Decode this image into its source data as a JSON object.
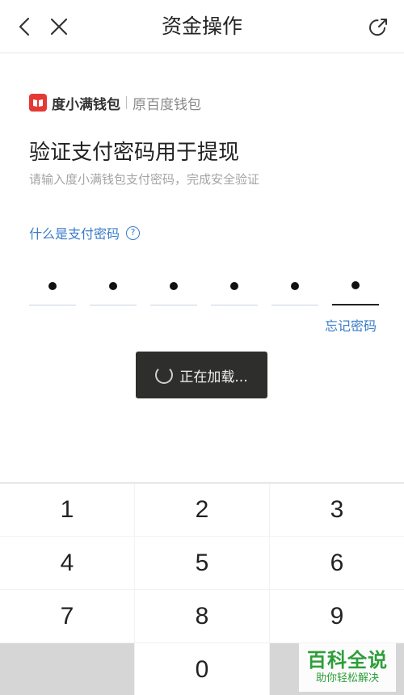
{
  "header": {
    "title": "资金操作"
  },
  "brand": {
    "name": "度小满钱包",
    "former_name": "原百度钱包",
    "color": "#e53935"
  },
  "main": {
    "heading": "验证支付密码用于提现",
    "subtitle": "请输入度小满钱包支付密码，完成安全验证",
    "help_link": "什么是支付密码",
    "help_icon_glyph": "?",
    "forgot_link": "忘记密码",
    "pin_length": 6,
    "pin_filled": 6
  },
  "toast": {
    "text": "正在加载..."
  },
  "keypad": {
    "keys": [
      "1",
      "2",
      "3",
      "4",
      "5",
      "6",
      "7",
      "8",
      "9",
      "",
      "0",
      ""
    ]
  },
  "watermark": {
    "title": "百科全说",
    "subtitle": "助你轻松解决"
  },
  "colors": {
    "link": "#3a7bc8",
    "toast_bg": "#2e2e2c",
    "watermark": "#2e9e3a"
  }
}
